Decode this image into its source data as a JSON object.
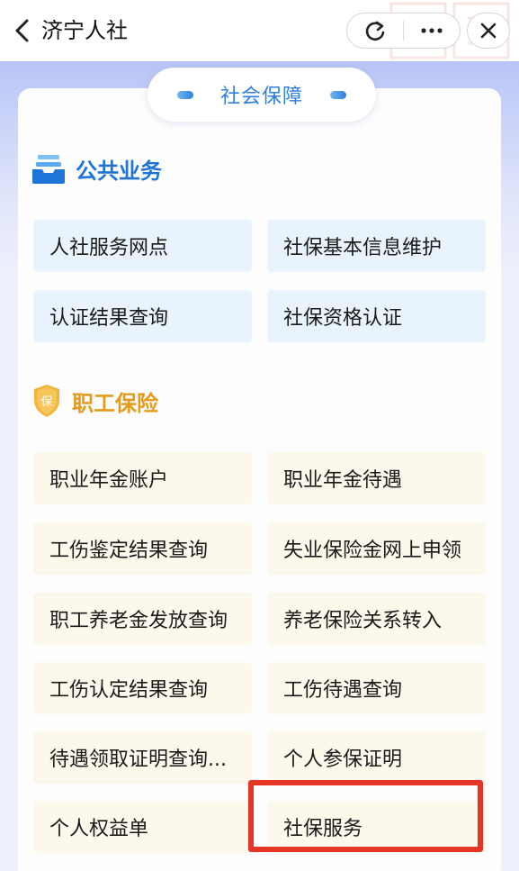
{
  "topbar": {
    "title": "济宁人社",
    "back_icon": "chevron-left-icon",
    "refresh_icon": "refresh-icon",
    "more_icon": "more-icon",
    "close_icon": "close-icon"
  },
  "section_tab": {
    "label": "社会保障"
  },
  "public_section": {
    "title": "公共业务",
    "icon": "inbox-tray-icon",
    "items": [
      {
        "label": "人社服务网点"
      },
      {
        "label": "社保基本信息维护"
      },
      {
        "label": "认证结果查询"
      },
      {
        "label": "社保资格认证"
      }
    ]
  },
  "worker_section": {
    "title": "职工保险",
    "icon": "shield-bao-icon",
    "badge_text": "保",
    "items": [
      {
        "label": "职业年金账户"
      },
      {
        "label": "职业年金待遇"
      },
      {
        "label": "工伤鉴定结果查询"
      },
      {
        "label": "失业保险金网上申领"
      },
      {
        "label": "职工养老金发放查询"
      },
      {
        "label": "养老保险关系转入"
      },
      {
        "label": "工伤认定结果查询"
      },
      {
        "label": "工伤待遇查询"
      },
      {
        "label": "待遇领取证明查询..."
      },
      {
        "label": "个人参保证明"
      },
      {
        "label": "个人权益单"
      },
      {
        "label": "社保服务"
      }
    ]
  },
  "colors": {
    "public_accent": "#1e74d8",
    "worker_accent": "#e59a1a",
    "highlight": "#e53525",
    "tile_blue": "#e9f3fd",
    "tile_cream": "#fdf8ec"
  }
}
